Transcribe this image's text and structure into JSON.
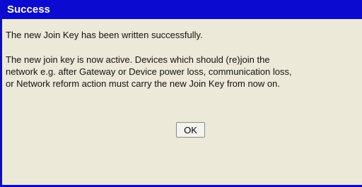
{
  "dialog": {
    "title": "Success",
    "message_line1": "The new Join Key has been written successfully.",
    "message_para2": [
      "The new join key is now active. Devices which should (re)join the",
      "network e.g. after Gateway or Device power loss, communication loss,",
      "or Network reform action must carry the new Join Key from now on."
    ],
    "ok_label": "OK"
  },
  "colors": {
    "title_bar": "#0a0ad0",
    "background": "#ece9d8",
    "title_text": "#ffffff"
  }
}
